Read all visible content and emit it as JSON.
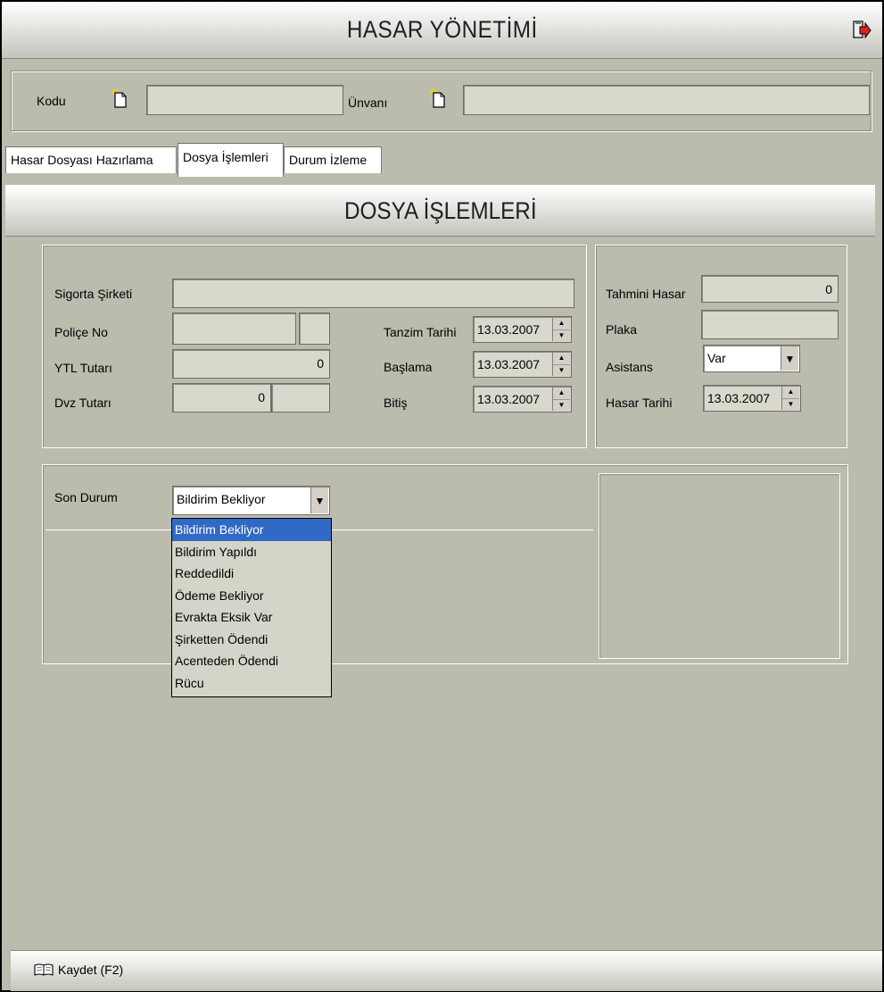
{
  "window": {
    "title": "HASAR YÖNETİMİ",
    "exit_icon": "exit-door-arrow-icon"
  },
  "top_panel": {
    "kodu_label": "Kodu",
    "unvani_label": "Ünvanı",
    "kodu_value": "",
    "unvani_value": ""
  },
  "tabs": [
    {
      "label": "Hasar Dosyası Hazırlama",
      "active": false
    },
    {
      "label": "Dosya İşlemleri",
      "active": true
    },
    {
      "label": "Durum İzleme",
      "active": false
    }
  ],
  "section": {
    "title": "DOSYA İŞLEMLERİ"
  },
  "policy": {
    "sigorta_sirketi_label": "Sigorta Şirketi",
    "sigorta_sirketi_value": "",
    "police_no_label": "Poliçe No",
    "police_no_value": "",
    "police_no_suffix": "",
    "ytl_tutari_label": "YTL  Tutarı",
    "ytl_tutari_value": "0",
    "dvz_tutari_label": "Dvz Tutarı",
    "dvz_tutari_value": "0",
    "dvz_currency": "",
    "tanzim_tarihi_label": "Tanzim Tarihi",
    "tanzim_tarihi_value": "13.03.2007",
    "baslama_label": "Başlama",
    "baslama_value": "13.03.2007",
    "bitis_label": "Bitiş",
    "bitis_value": "13.03.2007"
  },
  "damage": {
    "tahmini_hasar_label": "Tahmini Hasar",
    "tahmini_hasar_value": "0",
    "plaka_label": "Plaka",
    "plaka_value": "",
    "asistans_label": "Asistans",
    "asistans_value": "Var",
    "hasar_tarihi_label": "Hasar Tarihi",
    "hasar_tarihi_value": "13.03.2007"
  },
  "status": {
    "son_durum_label": "Son Durum",
    "son_durum_value": "Bildirim Bekliyor",
    "options": [
      "Bildirim Bekliyor",
      "Bildirim Yapıldı",
      "Reddedildi",
      "Ödeme Bekliyor",
      "Evrakta Eksik Var",
      "Şirketten Ödendi",
      "Acenteden Ödendi",
      "Rücu"
    ],
    "highlighted_option": "Bildirim Bekliyor"
  },
  "footer": {
    "save_label": "Kaydet (F2)",
    "save_icon": "book-icon"
  },
  "colors": {
    "background": "#bbbbae",
    "field": "#d8d8cc",
    "selection": "#316ac5",
    "exit_arrow": "#e02020"
  }
}
